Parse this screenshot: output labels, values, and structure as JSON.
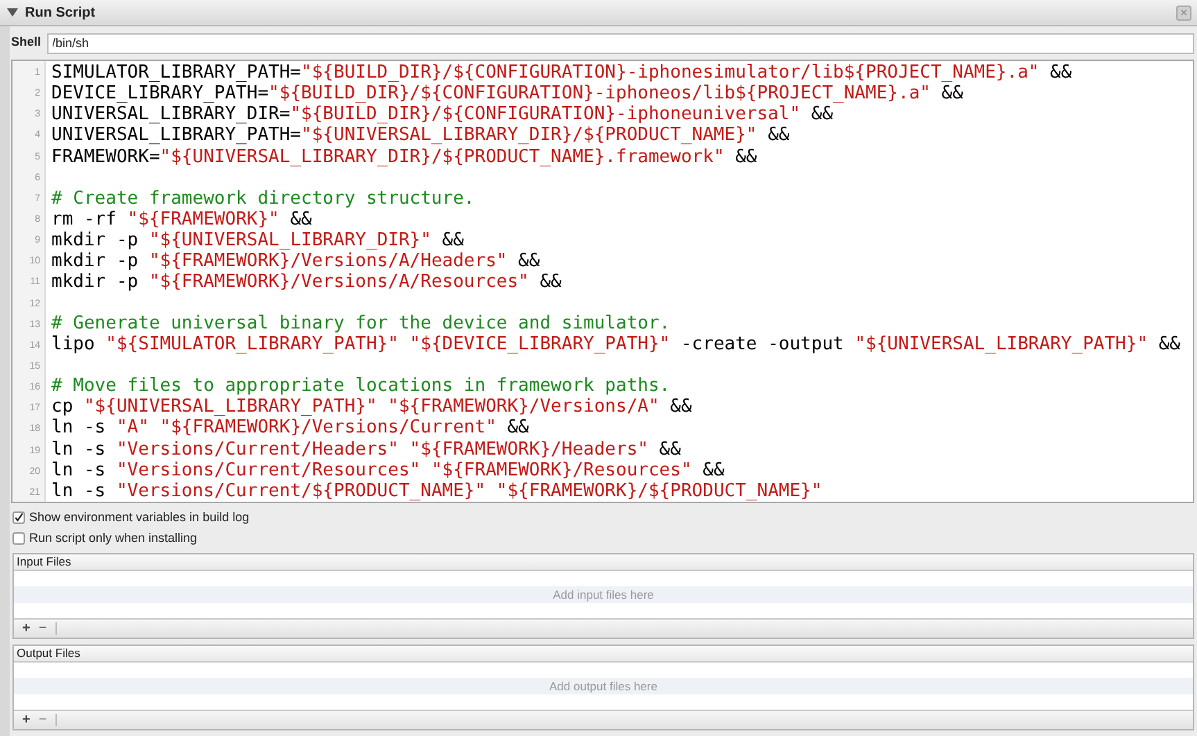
{
  "section": {
    "title": "Run Script",
    "expanded": true,
    "close": "×"
  },
  "shell": {
    "label": "Shell",
    "value": "/bin/sh"
  },
  "code_lines": [
    {
      "number": "1",
      "segments": [
        {
          "kind": "plain",
          "text": "SIMULATOR_LIBRARY_PATH="
        },
        {
          "kind": "string",
          "text": "\"${BUILD_DIR}/${CONFIGURATION}-iphonesimulator/lib${PROJECT_NAME}.a\""
        },
        {
          "kind": "plain",
          "text": " &&"
        }
      ]
    },
    {
      "number": "2",
      "segments": [
        {
          "kind": "plain",
          "text": "DEVICE_LIBRARY_PATH="
        },
        {
          "kind": "string",
          "text": "\"${BUILD_DIR}/${CONFIGURATION}-iphoneos/lib${PROJECT_NAME}.a\""
        },
        {
          "kind": "plain",
          "text": " &&"
        }
      ]
    },
    {
      "number": "3",
      "segments": [
        {
          "kind": "plain",
          "text": "UNIVERSAL_LIBRARY_DIR="
        },
        {
          "kind": "string",
          "text": "\"${BUILD_DIR}/${CONFIGURATION}-iphoneuniversal\""
        },
        {
          "kind": "plain",
          "text": " &&"
        }
      ]
    },
    {
      "number": "4",
      "segments": [
        {
          "kind": "plain",
          "text": "UNIVERSAL_LIBRARY_PATH="
        },
        {
          "kind": "string",
          "text": "\"${UNIVERSAL_LIBRARY_DIR}/${PRODUCT_NAME}\""
        },
        {
          "kind": "plain",
          "text": " &&"
        }
      ]
    },
    {
      "number": "5",
      "segments": [
        {
          "kind": "plain",
          "text": "FRAMEWORK="
        },
        {
          "kind": "string",
          "text": "\"${UNIVERSAL_LIBRARY_DIR}/${PRODUCT_NAME}.framework\""
        },
        {
          "kind": "plain",
          "text": " &&"
        }
      ]
    },
    {
      "number": "6"
    },
    {
      "number": "7",
      "segments": [
        {
          "kind": "comment",
          "text": "# Create framework directory structure."
        }
      ]
    },
    {
      "number": "8",
      "segments": [
        {
          "kind": "plain",
          "text": "rm -rf "
        },
        {
          "kind": "string",
          "text": "\"${FRAMEWORK}\""
        },
        {
          "kind": "plain",
          "text": " &&"
        }
      ]
    },
    {
      "number": "9",
      "segments": [
        {
          "kind": "plain",
          "text": "mkdir -p "
        },
        {
          "kind": "string",
          "text": "\"${UNIVERSAL_LIBRARY_DIR}\""
        },
        {
          "kind": "plain",
          "text": " &&"
        }
      ]
    },
    {
      "number": "10",
      "segments": [
        {
          "kind": "plain",
          "text": "mkdir -p "
        },
        {
          "kind": "string",
          "text": "\"${FRAMEWORK}/Versions/A/Headers\""
        },
        {
          "kind": "plain",
          "text": " &&"
        }
      ]
    },
    {
      "number": "11",
      "segments": [
        {
          "kind": "plain",
          "text": "mkdir -p "
        },
        {
          "kind": "string",
          "text": "\"${FRAMEWORK}/Versions/A/Resources\""
        },
        {
          "kind": "plain",
          "text": " &&"
        }
      ]
    },
    {
      "number": "12"
    },
    {
      "number": "13",
      "segments": [
        {
          "kind": "comment",
          "text": "# Generate universal binary for the device and simulator."
        }
      ]
    },
    {
      "number": "14",
      "segments": [
        {
          "kind": "plain",
          "text": "lipo "
        },
        {
          "kind": "string",
          "text": "\"${SIMULATOR_LIBRARY_PATH}\""
        },
        {
          "kind": "string",
          "text": " \"${DEVICE_LIBRARY_PATH}\""
        },
        {
          "kind": "plain",
          "text": " -create -output "
        },
        {
          "kind": "string",
          "text": "\"${UNIVERSAL_LIBRARY_PATH}\""
        },
        {
          "kind": "plain",
          "text": " &&"
        }
      ]
    },
    {
      "number": "15"
    },
    {
      "number": "16",
      "segments": [
        {
          "kind": "comment",
          "text": "# Move files to appropriate locations in framework paths."
        }
      ]
    },
    {
      "number": "17",
      "segments": [
        {
          "kind": "plain",
          "text": "cp "
        },
        {
          "kind": "string",
          "text": "\"${UNIVERSAL_LIBRARY_PATH}\""
        },
        {
          "kind": "string",
          "text": " \"${FRAMEWORK}/Versions/A\""
        },
        {
          "kind": "plain",
          "text": " &&"
        }
      ]
    },
    {
      "number": "18",
      "segments": [
        {
          "kind": "plain",
          "text": "ln -s "
        },
        {
          "kind": "string",
          "text": "\"A\""
        },
        {
          "kind": "string",
          "text": " \"${FRAMEWORK}/Versions/Current\""
        },
        {
          "kind": "plain",
          "text": " &&"
        }
      ]
    },
    {
      "number": "19",
      "segments": [
        {
          "kind": "plain",
          "text": "ln -s "
        },
        {
          "kind": "string",
          "text": "\"Versions/Current/Headers\""
        },
        {
          "kind": "string",
          "text": " \"${FRAMEWORK}/Headers\""
        },
        {
          "kind": "plain",
          "text": " &&"
        }
      ]
    },
    {
      "number": "20",
      "segments": [
        {
          "kind": "plain",
          "text": "ln -s "
        },
        {
          "kind": "string",
          "text": "\"Versions/Current/Resources\""
        },
        {
          "kind": "string",
          "text": " \"${FRAMEWORK}/Resources\""
        },
        {
          "kind": "plain",
          "text": " &&"
        }
      ]
    },
    {
      "number": "21",
      "segments": [
        {
          "kind": "plain",
          "text": "ln -s "
        },
        {
          "kind": "string",
          "text": "\"Versions/Current/${PRODUCT_NAME}\""
        },
        {
          "kind": "string",
          "text": " \"${FRAMEWORK}/${PRODUCT_NAME}\""
        }
      ]
    }
  ],
  "options": [
    {
      "label": "Show environment variables in build log",
      "checked": true
    },
    {
      "label": "Run script only when installing",
      "checked": false
    }
  ],
  "file_lists": [
    {
      "title": "Input Files",
      "placeholder": "Add input files here",
      "add": "+",
      "remove": "−"
    },
    {
      "title": "Output Files",
      "placeholder": "Add output files here",
      "add": "+",
      "remove": "−"
    }
  ]
}
